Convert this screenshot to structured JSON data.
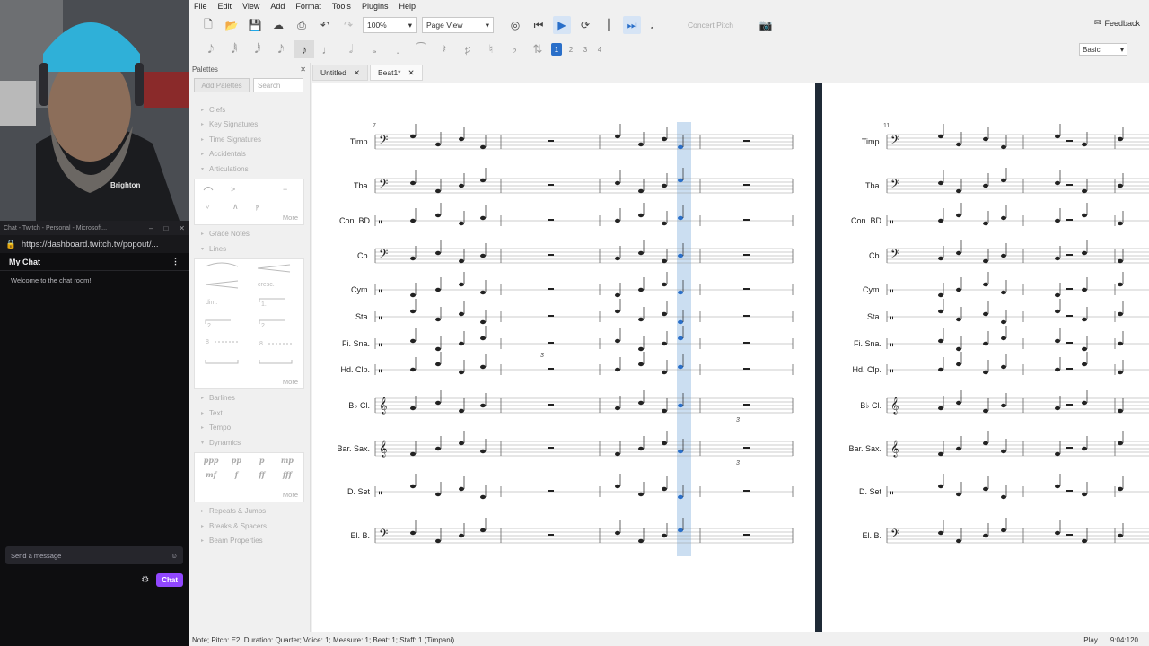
{
  "chat": {
    "title_bar": "Chat - Twitch - Personal - Microsoft...",
    "url": "https://dashboard.twitch.tv/popout/...",
    "header": "My Chat",
    "welcome": "Welcome to the chat room!",
    "input_placeholder": "Send a message",
    "chat_button": "Chat",
    "cam_logo": "Brighton"
  },
  "menu": [
    "File",
    "Edit",
    "View",
    "Add",
    "Format",
    "Tools",
    "Plugins",
    "Help"
  ],
  "toolbar": {
    "zoom": "100%",
    "view_mode": "Page View",
    "concert_pitch": "Concert Pitch",
    "feedback": "Feedback",
    "workspace": "Basic",
    "voices": [
      "1",
      "2",
      "3",
      "4"
    ]
  },
  "palettes": {
    "title": "Palettes",
    "add_button": "Add Palettes",
    "search_placeholder": "Search",
    "groups_a": [
      "Clefs",
      "Key Signatures",
      "Time Signatures",
      "Accidentals",
      "Articulations"
    ],
    "groups_b": [
      "Grace Notes",
      "Lines"
    ],
    "groups_c": [
      "Barlines",
      "Text",
      "Tempo",
      "Dynamics"
    ],
    "groups_d": [
      "Repeats & Jumps",
      "Breaks & Spacers",
      "Beam Properties"
    ],
    "more": "More",
    "dynamics": [
      "ppp",
      "pp",
      "p",
      "mp",
      "mf",
      "f",
      "ff",
      "fff"
    ]
  },
  "tabs": [
    {
      "label": "Untitled"
    },
    {
      "label": "Beat1*"
    }
  ],
  "score": {
    "measure_left": "7",
    "measure_right": "11",
    "tuplet": "3",
    "instruments": [
      "Timp.",
      "Tba.",
      "Con. BD",
      "Cb.",
      "Cym.",
      "Sta.",
      "Fi. Sna.",
      "Hd. Clp.",
      "B♭ Cl.",
      "Bar. Sax.",
      "D. Set",
      "El. B."
    ]
  },
  "status": {
    "left": "Note; Pitch: E2; Duration: Quarter; Voice: 1;  Measure: 1; Beat: 1; Staff: 1 (Timpani)",
    "mode": "Play",
    "time": "9:04:120"
  },
  "colors": {
    "accent": "#2a6fc9",
    "playback_highlight": "#b9d3ec",
    "twitch_purple": "#9147ff"
  }
}
